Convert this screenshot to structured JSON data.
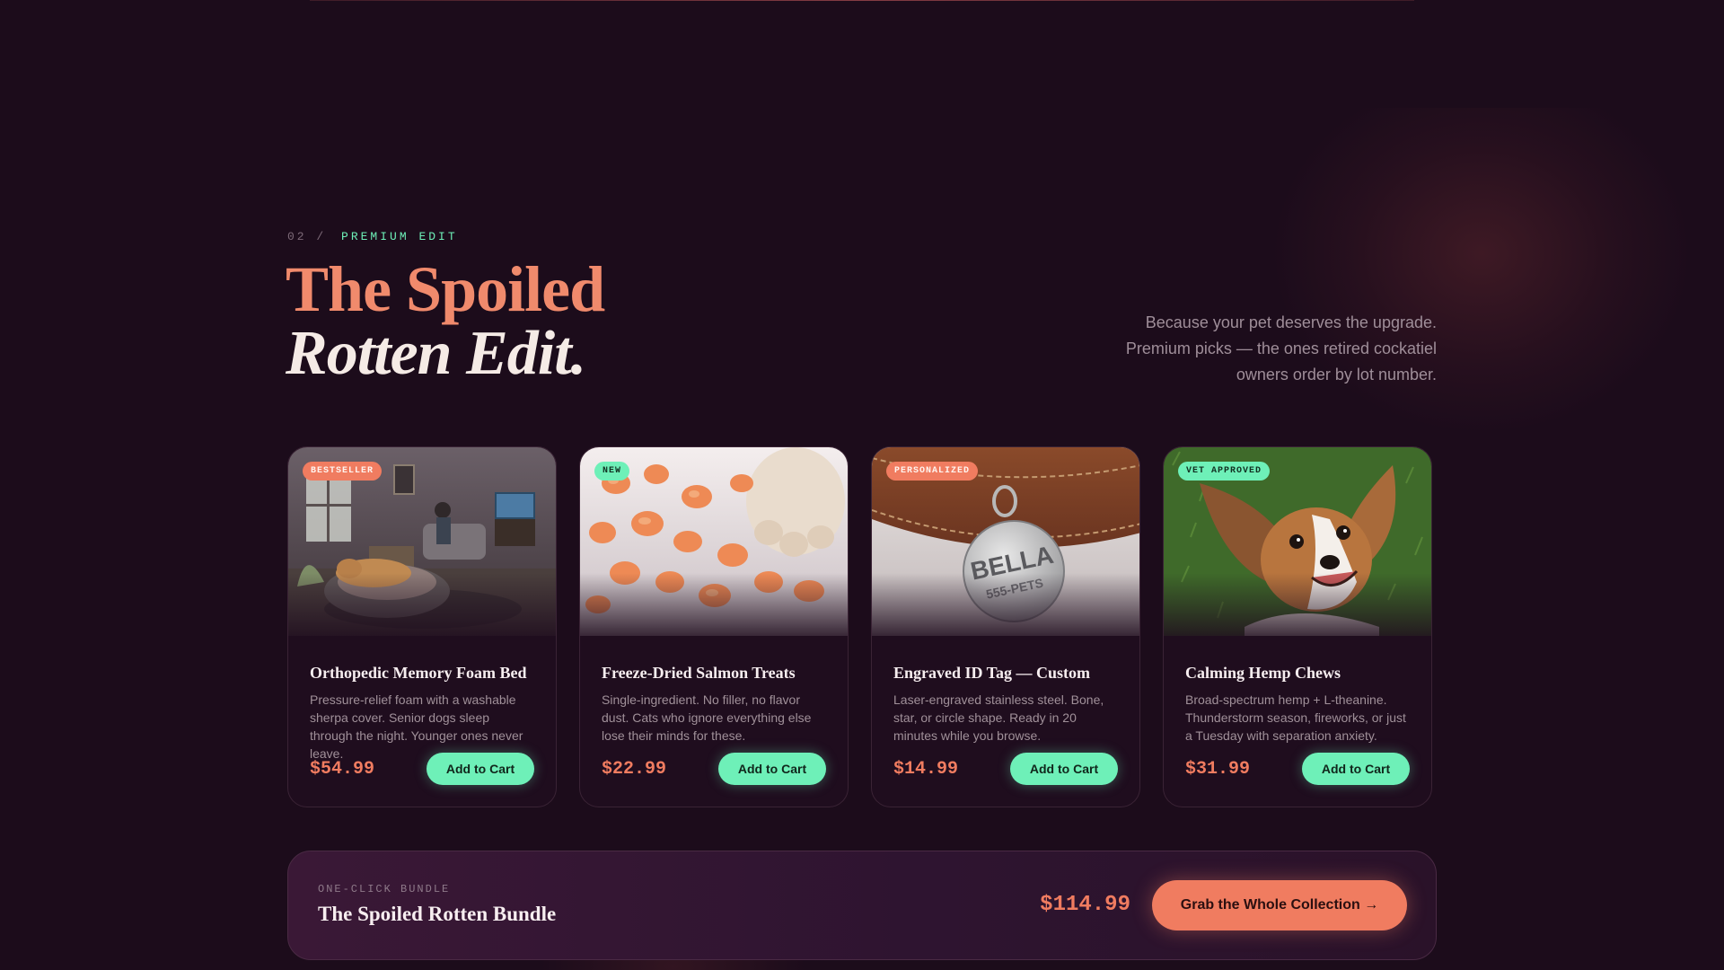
{
  "section": {
    "number": "02  /",
    "label": "PREMIUM EDIT",
    "title_line1": "The Spoiled",
    "title_line2": "Rotten Edit.",
    "intro": "Because your pet deserves the upgrade. Premium picks — the ones retired cockatiel owners order by lot number."
  },
  "products": [
    {
      "badge": "BESTSELLER",
      "badge_color": "#f07c60",
      "image": "dog-on-bed-living-room",
      "title": "Orthopedic Memory Foam Bed",
      "desc": "Pressure-relief foam with a washable sherpa cover. Senior dogs sleep through the night. Younger ones never leave.",
      "price": "$54.99",
      "cta": "Add to Cart"
    },
    {
      "badge": "NEW",
      "badge_color": "#6ef0b8",
      "image": "salmon-treats-paw",
      "title": "Freeze-Dried Salmon Treats",
      "desc": "Single-ingredient. No filler, no flavor dust. Cats who ignore everything else lose their minds for these.",
      "price": "$22.99",
      "cta": "Add to Cart"
    },
    {
      "badge": "PERSONALIZED",
      "badge_color": "#f07c60",
      "image": "engraved-collar-tag",
      "tag_name": "BELLA",
      "tag_phone": "555-PETS",
      "title": "Engraved ID Tag — Custom",
      "desc": "Laser-engraved stainless steel. Bone, star, or circle shape. Ready in 20 minutes while you browse.",
      "price": "$14.99",
      "cta": "Add to Cart"
    },
    {
      "badge": "VET APPROVED",
      "badge_color": "#6ef0b8",
      "image": "happy-beagle-grass",
      "title": "Calming Hemp Chews",
      "desc": "Broad-spectrum hemp + L-theanine. Thunderstorm season, fireworks, or just a Tuesday with separation anxiety.",
      "price": "$31.99",
      "cta": "Add to Cart"
    }
  ],
  "bundle": {
    "eyebrow": "ONE-CLICK BUNDLE",
    "title": "The Spoiled Rotten Bundle",
    "price": "$114.99",
    "cta": "Grab the Whole Collection →"
  }
}
